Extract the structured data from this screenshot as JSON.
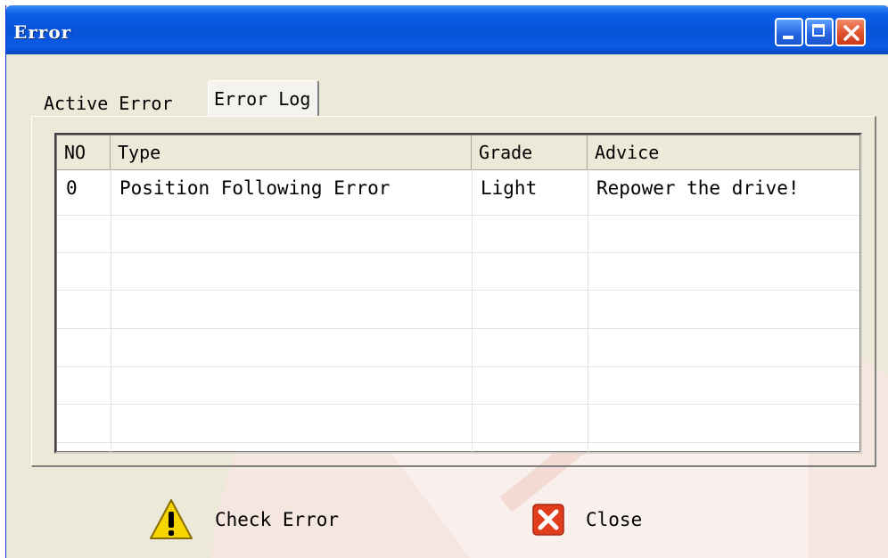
{
  "window": {
    "title": "Error"
  },
  "tabs": [
    {
      "label": "Active Error"
    },
    {
      "label": "Error Log"
    }
  ],
  "table": {
    "columns": [
      "NO",
      "Type",
      "Grade",
      "Advice"
    ],
    "rows": [
      {
        "no": "0",
        "type": "Position Following Error",
        "grade": "Light",
        "advice": "Repower the drive!"
      }
    ]
  },
  "buttons": {
    "check_error": "Check Error",
    "close": "Close"
  },
  "colors": {
    "title_bar": "#0853d8",
    "dialog_bg": "#ece9d8",
    "warning_yellow": "#f6d500",
    "close_red": "#e03c1e"
  },
  "icons": {
    "check_error": "warning-icon",
    "close": "close-icon"
  }
}
